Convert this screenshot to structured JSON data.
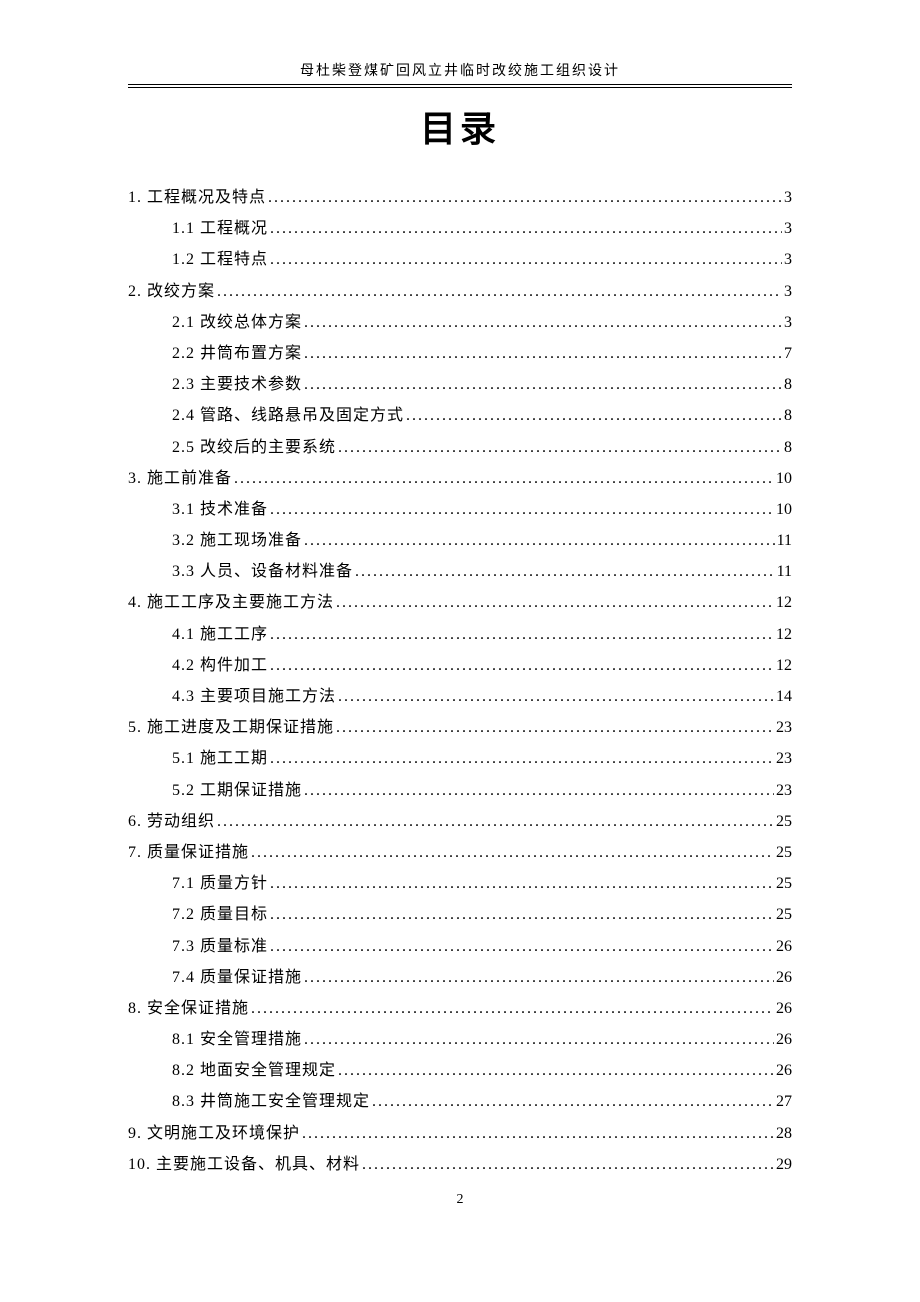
{
  "header": "母杜柴登煤矿回风立井临时改绞施工组织设计",
  "title": "目录",
  "toc": [
    {
      "level": 1,
      "label": "1.  工程概况及特点",
      "page": "3"
    },
    {
      "level": 2,
      "label": "1.1 工程概况",
      "page": "3"
    },
    {
      "level": 2,
      "label": "1.2 工程特点",
      "page": "3"
    },
    {
      "level": 1,
      "label": "2.  改绞方案",
      "page": "3"
    },
    {
      "level": 2,
      "label": "2.1 改绞总体方案",
      "page": "3"
    },
    {
      "level": 2,
      "label": "2.2 井筒布置方案",
      "page": "7"
    },
    {
      "level": 2,
      "label": "2.3 主要技术参数",
      "page": "8"
    },
    {
      "level": 2,
      "label": "2.4 管路、线路悬吊及固定方式",
      "page": "8"
    },
    {
      "level": 2,
      "label": "2.5 改绞后的主要系统",
      "page": "8"
    },
    {
      "level": 1,
      "label": "3. 施工前准备",
      "page": "10"
    },
    {
      "level": 2,
      "label": "3.1 技术准备",
      "page": "10"
    },
    {
      "level": 2,
      "label": "3.2  施工现场准备",
      "page": "11"
    },
    {
      "level": 2,
      "label": "3.3  人员、设备材料准备",
      "page": "11"
    },
    {
      "level": 1,
      "label": "4.  施工工序及主要施工方法",
      "page": "12"
    },
    {
      "level": 2,
      "label": "4.1 施工工序",
      "page": "12"
    },
    {
      "level": 2,
      "label": "4.2 构件加工",
      "page": "12"
    },
    {
      "level": 2,
      "label": "4.3 主要项目施工方法",
      "page": "14"
    },
    {
      "level": 1,
      "label": "5.  施工进度及工期保证措施",
      "page": "23"
    },
    {
      "level": 2,
      "label": "5.1 施工工期",
      "page": "23"
    },
    {
      "level": 2,
      "label": "5.2 工期保证措施",
      "page": "23"
    },
    {
      "level": 1,
      "label": "6.  劳动组织",
      "page": "25"
    },
    {
      "level": 1,
      "label": "7.  质量保证措施",
      "page": "25"
    },
    {
      "level": 2,
      "label": "7.1 质量方针",
      "page": "25"
    },
    {
      "level": 2,
      "label": "7.2 质量目标",
      "page": "25"
    },
    {
      "level": 2,
      "label": "7.3  质量标准",
      "page": "26"
    },
    {
      "level": 2,
      "label": "7.4 质量保证措施",
      "page": "26"
    },
    {
      "level": 1,
      "label": "8.  安全保证措施",
      "page": "26"
    },
    {
      "level": 2,
      "label": "8.1 安全管理措施",
      "page": "26"
    },
    {
      "level": 2,
      "label": "8.2 地面安全管理规定",
      "page": "26"
    },
    {
      "level": 2,
      "label": "8.3 井筒施工安全管理规定",
      "page": "27"
    },
    {
      "level": 1,
      "label": "9.  文明施工及环境保护",
      "page": "28"
    },
    {
      "level": 1,
      "label": "10. 主要施工设备、机具、材料",
      "page": "29"
    }
  ],
  "page_number": "2"
}
